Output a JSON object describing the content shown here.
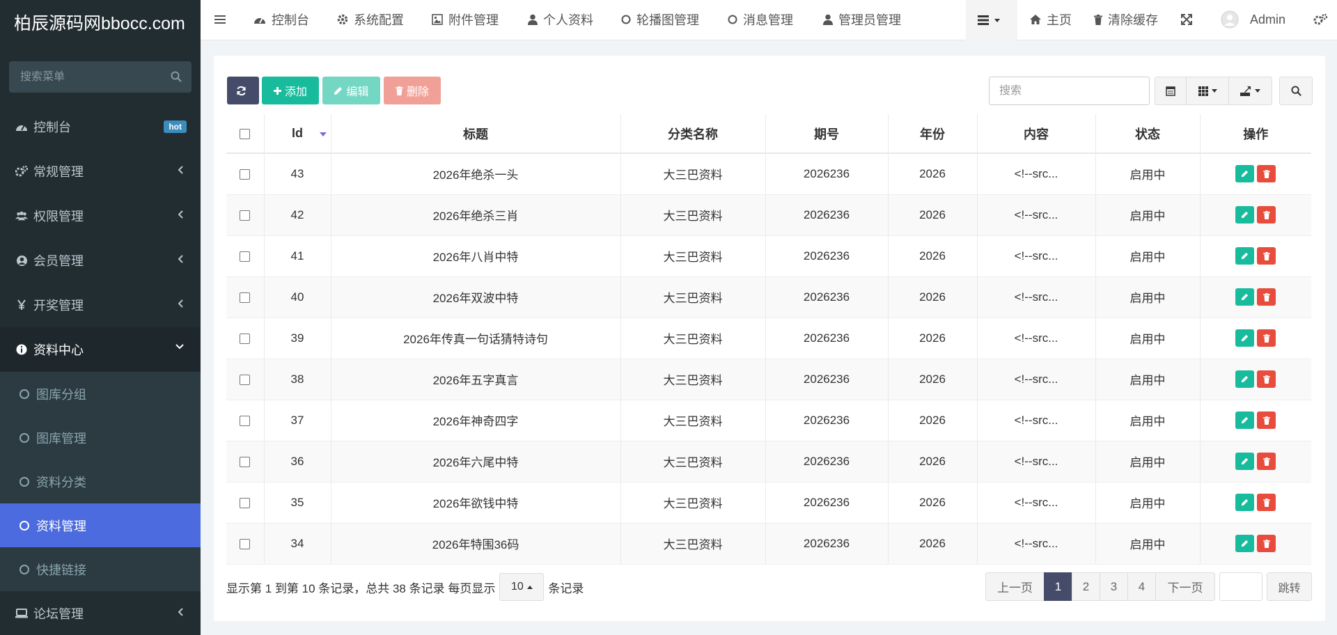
{
  "app": {
    "logo": "柏辰源码网bbocc.com"
  },
  "sidebar": {
    "search_placeholder": "搜索菜单",
    "items": [
      {
        "label": "控制台",
        "badge": "hot",
        "icon": "dashboard-icon"
      },
      {
        "label": "常规管理",
        "icon": "cogs-icon"
      },
      {
        "label": "权限管理",
        "icon": "group-icon"
      },
      {
        "label": "会员管理",
        "icon": "user-circle-icon"
      },
      {
        "label": "开奖管理",
        "icon": "yen-icon"
      },
      {
        "label": "资料中心",
        "icon": "info-icon",
        "expanded": true
      },
      {
        "label": "论坛管理",
        "icon": "laptop-icon"
      }
    ],
    "sub_items": [
      {
        "label": "图库分组"
      },
      {
        "label": "图库管理"
      },
      {
        "label": "资料分类"
      },
      {
        "label": "资料管理",
        "active": true
      },
      {
        "label": "快捷链接"
      }
    ]
  },
  "topbar": {
    "tabs": [
      {
        "label": "控制台",
        "icon": "dashboard-icon"
      },
      {
        "label": "系统配置",
        "icon": "gear-icon"
      },
      {
        "label": "附件管理",
        "icon": "image-icon"
      },
      {
        "label": "个人资料",
        "icon": "user-icon"
      },
      {
        "label": "轮播图管理",
        "icon": "circle-icon"
      },
      {
        "label": "消息管理",
        "icon": "circle-icon"
      },
      {
        "label": "管理员管理",
        "icon": "user-icon"
      }
    ],
    "home": "主页",
    "clear_cache": "清除缓存",
    "user": "Admin"
  },
  "toolbar": {
    "add": "添加",
    "edit": "编辑",
    "delete": "删除",
    "search_placeholder": "搜索"
  },
  "table": {
    "columns": [
      "Id",
      "标题",
      "分类名称",
      "期号",
      "年份",
      "内容",
      "状态",
      "操作"
    ],
    "rows": [
      {
        "id": "43",
        "title": "2026年绝杀一头",
        "category": "大三巴资料",
        "issue": "2026236",
        "year": "2026",
        "content": "<!--src...",
        "status": "启用中"
      },
      {
        "id": "42",
        "title": "2026年绝杀三肖",
        "category": "大三巴资料",
        "issue": "2026236",
        "year": "2026",
        "content": "<!--src...",
        "status": "启用中"
      },
      {
        "id": "41",
        "title": "2026年八肖中特",
        "category": "大三巴资料",
        "issue": "2026236",
        "year": "2026",
        "content": "<!--src...",
        "status": "启用中"
      },
      {
        "id": "40",
        "title": "2026年双波中特",
        "category": "大三巴资料",
        "issue": "2026236",
        "year": "2026",
        "content": "<!--src...",
        "status": "启用中"
      },
      {
        "id": "39",
        "title": "2026年传真一句话猜特诗句",
        "category": "大三巴资料",
        "issue": "2026236",
        "year": "2026",
        "content": "<!--src...",
        "status": "启用中"
      },
      {
        "id": "38",
        "title": "2026年五字真言",
        "category": "大三巴资料",
        "issue": "2026236",
        "year": "2026",
        "content": "<!--src...",
        "status": "启用中"
      },
      {
        "id": "37",
        "title": "2026年神奇四字",
        "category": "大三巴资料",
        "issue": "2026236",
        "year": "2026",
        "content": "<!--src...",
        "status": "启用中"
      },
      {
        "id": "36",
        "title": "2026年六尾中特",
        "category": "大三巴资料",
        "issue": "2026236",
        "year": "2026",
        "content": "<!--src...",
        "status": "启用中"
      },
      {
        "id": "35",
        "title": "2026年欲钱中特",
        "category": "大三巴资料",
        "issue": "2026236",
        "year": "2026",
        "content": "<!--src...",
        "status": "启用中"
      },
      {
        "id": "34",
        "title": "2026年特围36码",
        "category": "大三巴资料",
        "issue": "2026236",
        "year": "2026",
        "content": "<!--src...",
        "status": "启用中"
      }
    ]
  },
  "footer": {
    "summary": "显示第 1 到第 10 条记录，总共 38 条记录 每页显示",
    "page_size": "10",
    "suffix": "条记录",
    "prev": "上一页",
    "pages": [
      "1",
      "2",
      "3",
      "4"
    ],
    "current_page": "1",
    "next": "下一页",
    "jump": "跳转"
  },
  "colors": {
    "sidebar_bg": "#222d32",
    "active_menu": "#4c6bdf",
    "primary_dark": "#444c69",
    "success": "#18bc9c",
    "danger": "#e74c3c",
    "badge": "#3c8dbc"
  }
}
